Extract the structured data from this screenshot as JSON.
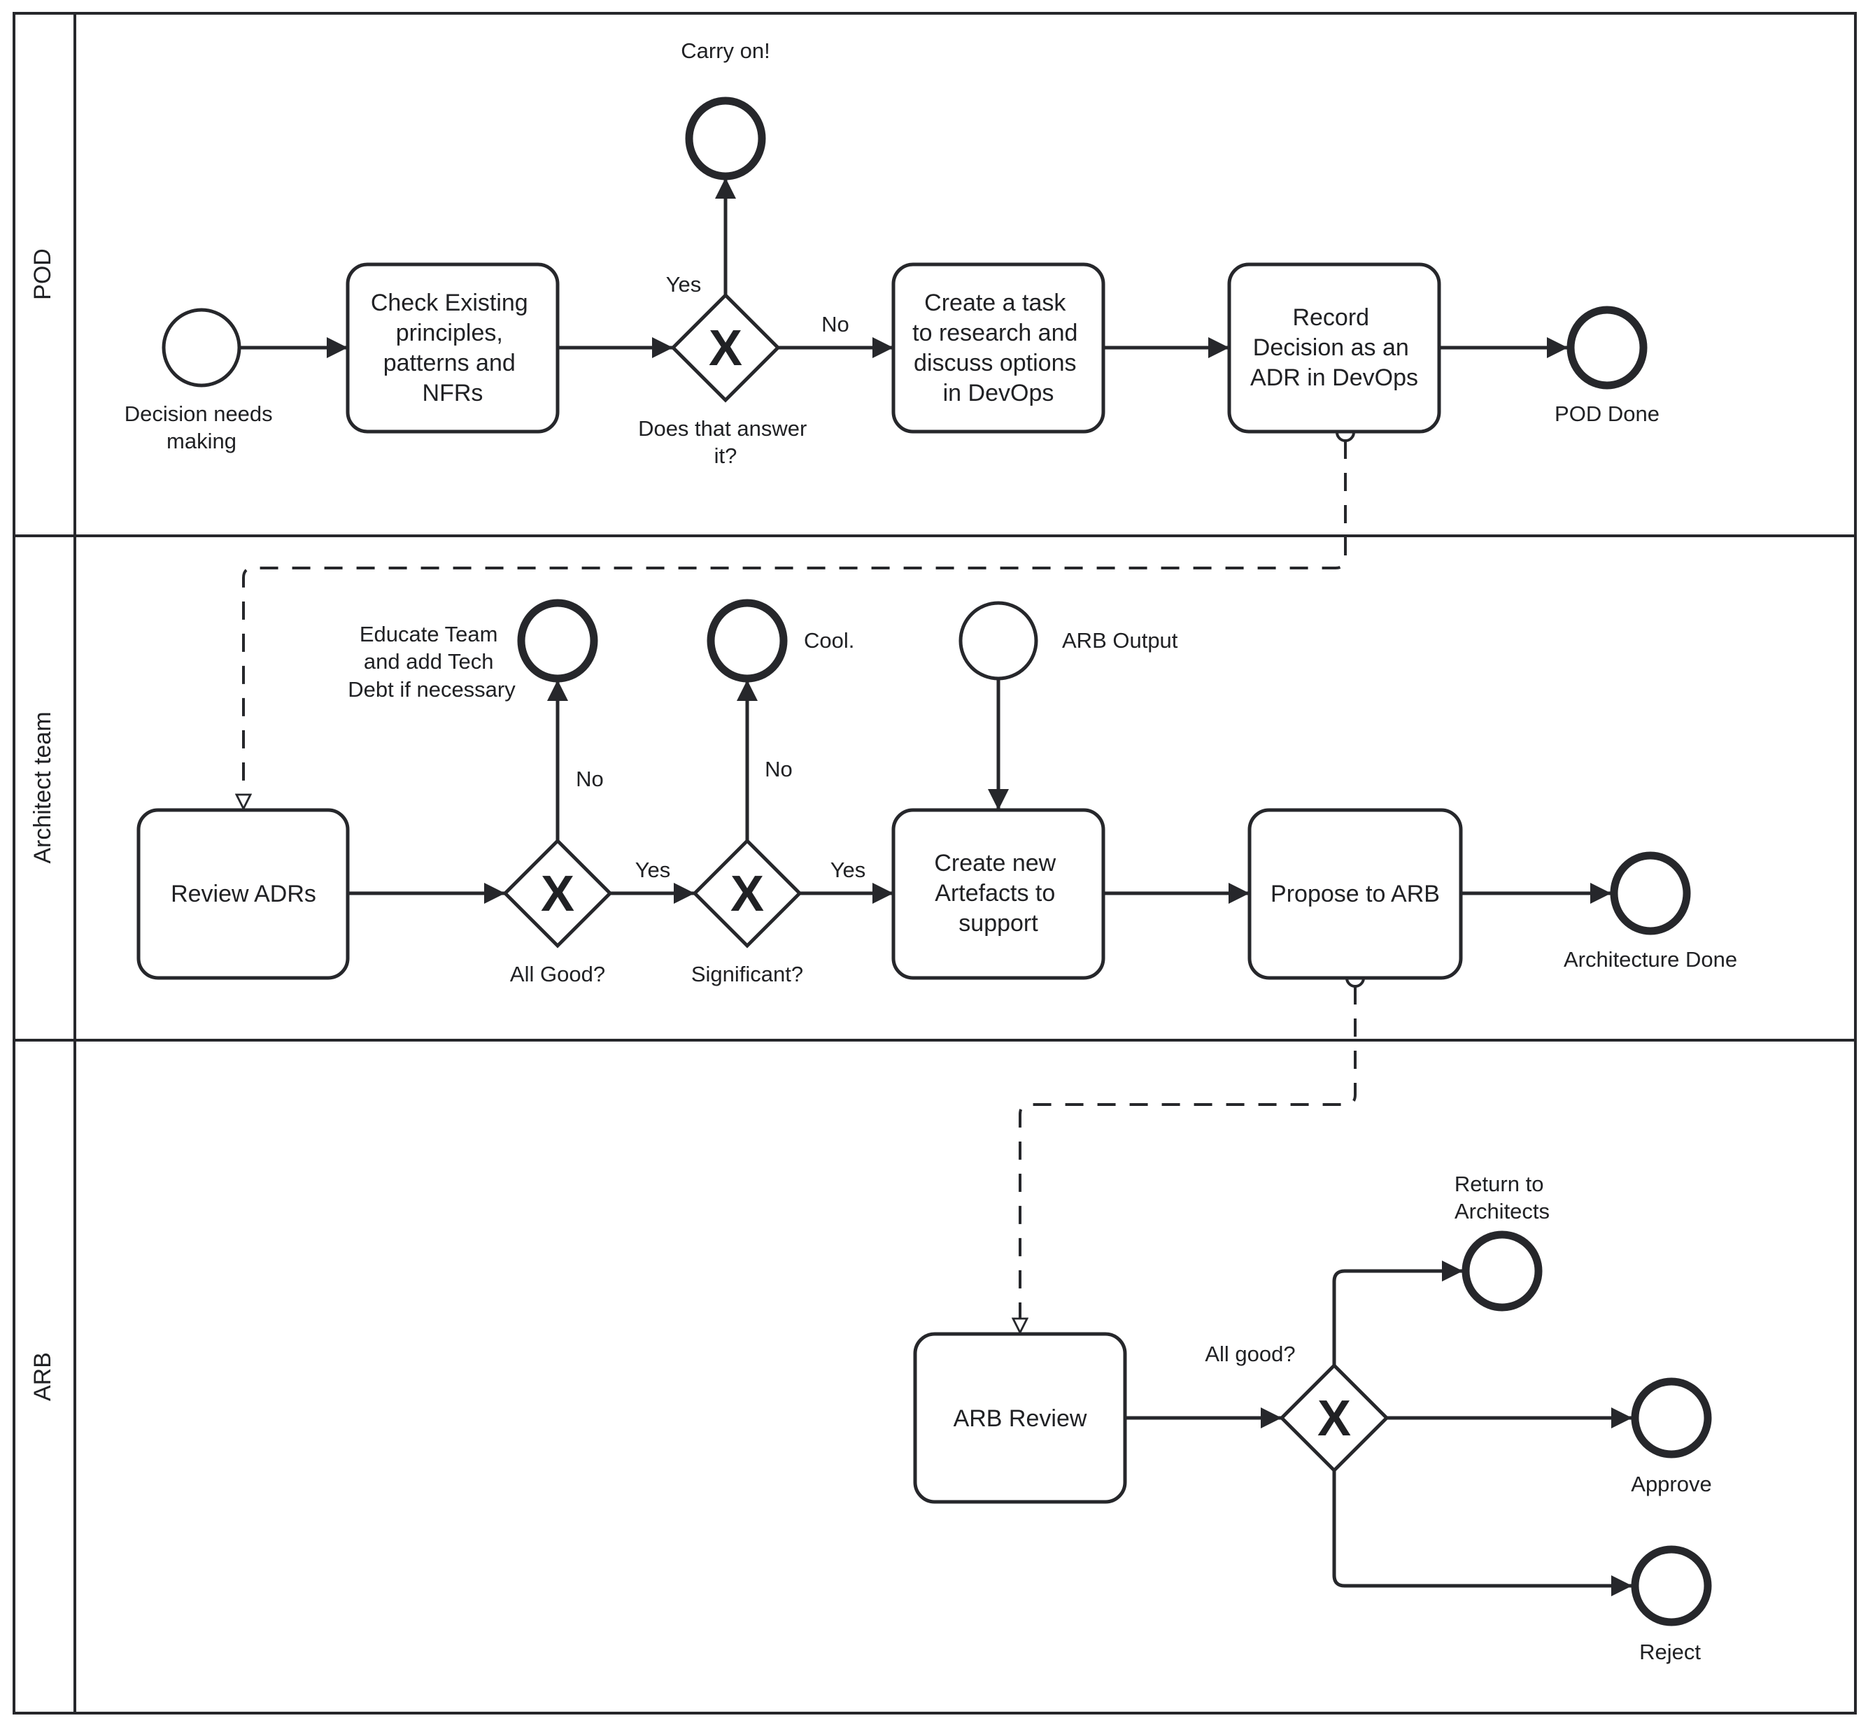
{
  "diagram": {
    "type": "bpmn-swimlane",
    "lanes": [
      {
        "id": "pod",
        "title": "POD"
      },
      {
        "id": "arch",
        "title": "Architect team"
      },
      {
        "id": "arb",
        "title": "ARB"
      }
    ],
    "tasks": {
      "check_existing": [
        "Check Existing",
        "principles,",
        "patterns and",
        "NFRs"
      ],
      "create_task": [
        "Create a task",
        "to research and",
        "discuss options",
        "in DevOps"
      ],
      "record_decision": [
        "Record",
        "Decision as an",
        "ADR in DevOps"
      ],
      "review_adrs": [
        "Review ADRs"
      ],
      "create_artefacts": [
        "Create new",
        "Artefacts to",
        "support"
      ],
      "propose_arb": [
        "Propose to ARB"
      ],
      "arb_review": [
        "ARB Review"
      ]
    },
    "events": {
      "decision_start": [
        "Decision needs",
        "making"
      ],
      "carry_on": [
        "Carry on!"
      ],
      "pod_done": [
        "POD Done"
      ],
      "educate_team": [
        "Educate Team",
        "and add Tech",
        "Debt if necessary"
      ],
      "cool": [
        "Cool."
      ],
      "arb_output": [
        "ARB Output"
      ],
      "architecture_done": [
        "Architecture Done"
      ],
      "return_architects": [
        "Return to",
        "Architects"
      ],
      "approve": [
        "Approve"
      ],
      "reject": [
        "Reject"
      ]
    },
    "gateways": {
      "answer_it": [
        "Does that answer",
        "it?"
      ],
      "all_good_arch": [
        "All Good?"
      ],
      "significant": [
        "Significant?"
      ],
      "all_good_arb": [
        "All good?"
      ]
    },
    "gateway_marker": "X",
    "flow_labels": {
      "answer_yes": "Yes",
      "answer_no": "No",
      "allgood_no": "No",
      "allgood_yes": "Yes",
      "significant_no": "No",
      "significant_yes": "Yes"
    },
    "colors": {
      "stroke": "#26272b",
      "text": "#202124",
      "background": "#ffffff"
    }
  }
}
